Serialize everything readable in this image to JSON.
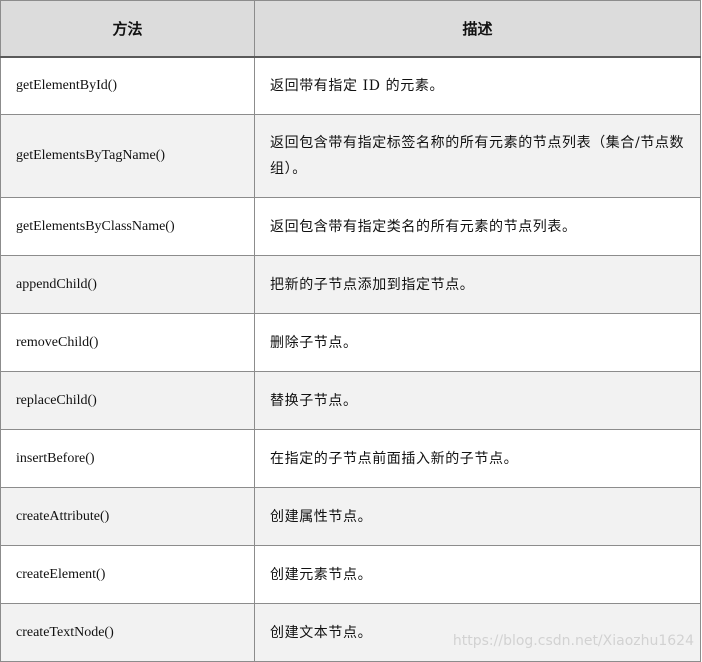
{
  "table": {
    "headers": [
      "方法",
      "描述"
    ],
    "rows": [
      {
        "method": "getElementById()",
        "description": "返回带有指定 ID 的元素。"
      },
      {
        "method": "getElementsByTagName()",
        "description": "返回包含带有指定标签名称的所有元素的节点列表（集合/节点数组）。"
      },
      {
        "method": "getElementsByClassName()",
        "description": "返回包含带有指定类名的所有元素的节点列表。"
      },
      {
        "method": "appendChild()",
        "description": "把新的子节点添加到指定节点。"
      },
      {
        "method": "removeChild()",
        "description": "删除子节点。"
      },
      {
        "method": "replaceChild()",
        "description": "替换子节点。"
      },
      {
        "method": "insertBefore()",
        "description": "在指定的子节点前面插入新的子节点。"
      },
      {
        "method": "createAttribute()",
        "description": "创建属性节点。"
      },
      {
        "method": "createElement()",
        "description": "创建元素节点。"
      },
      {
        "method": "createTextNode()",
        "description": "创建文本节点。"
      }
    ]
  },
  "watermark": "https://blog.csdn.net/Xiaozhu1624",
  "colors": {
    "header_bg": "#dcdcdc",
    "row_alt_bg": "#f2f2f2",
    "border": "#8c8c8c",
    "watermark": "#d2d2d2"
  }
}
